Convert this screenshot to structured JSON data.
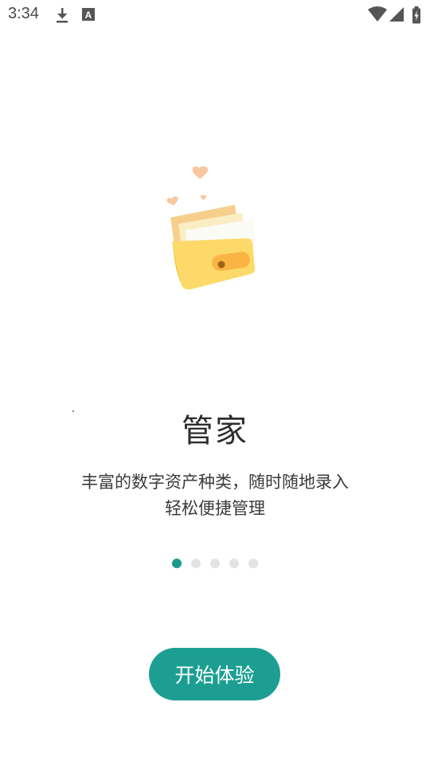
{
  "status_bar": {
    "time": "3:34",
    "icons": [
      "download-icon",
      "font-a-icon",
      "wifi-icon",
      "cell-signal-icon",
      "battery-charging-icon"
    ]
  },
  "onboarding": {
    "illustration": "wallet-with-cards-icon",
    "title": "管家",
    "description_line1": "丰富的数字资产种类，随时随地录入",
    "description_line2": "轻松便捷管理",
    "page_count": 5,
    "active_page": 1,
    "start_button_label": "开始体验"
  },
  "colors": {
    "accent": "#1c9f92",
    "dot_inactive": "#e3e3e3",
    "wallet_yellow": "#fcd969",
    "heart": "#f8c7a1"
  }
}
